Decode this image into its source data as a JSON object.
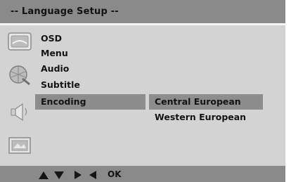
{
  "header": {
    "title": "-- Language  Setup --"
  },
  "sidebar_icons": [
    "general-setup-icon",
    "video-setup-icon",
    "audio-setup-icon",
    "preference-setup-icon"
  ],
  "menu": {
    "items": [
      {
        "label": "OSD"
      },
      {
        "label": "Menu"
      },
      {
        "label": "Audio"
      },
      {
        "label": "Subtitle"
      },
      {
        "label": "Encoding"
      }
    ],
    "selected_index": 4
  },
  "options": {
    "items": [
      {
        "label": "Central European"
      },
      {
        "label": "Western European"
      }
    ],
    "selected_index": 0
  },
  "footer": {
    "arrows": [
      "up-arrow-icon",
      "down-arrow-icon",
      "right-arrow-icon",
      "left-arrow-icon"
    ],
    "ok_label": "OK"
  },
  "colors": {
    "background": "#d3d3d3",
    "bar": "#8a8a8a",
    "highlight": "#8d8d8d",
    "text": "#141414"
  }
}
